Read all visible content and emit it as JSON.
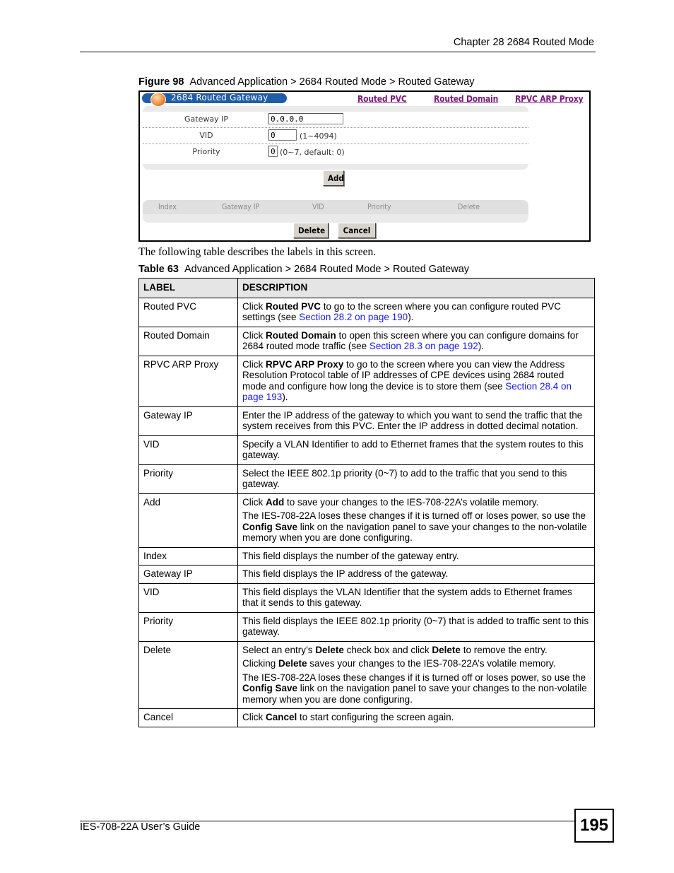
{
  "header": {
    "chapter": "Chapter 28 2684 Routed Mode"
  },
  "figure": {
    "label": "Figure 98",
    "caption": "Advanced Application > 2684 Routed Mode > Routed Gateway",
    "screen": {
      "title": "2684 Routed Gateway",
      "title_icon": "orange-ball-icon",
      "tabs": [
        {
          "label": "Routed PVC"
        },
        {
          "label": "Routed Domain"
        },
        {
          "label": "RPVC ARP Proxy"
        }
      ],
      "fields": [
        {
          "label": "Gateway IP",
          "value": "0.0.0.0",
          "hint": ""
        },
        {
          "label": "VID",
          "value": "0",
          "hint": "(1~4094)"
        },
        {
          "label": "Priority",
          "value": "0",
          "hint": "(0~7, default: 0)"
        }
      ],
      "add_label": "Add",
      "list_columns": [
        "Index",
        "Gateway IP",
        "VID",
        "Priority",
        "Delete"
      ],
      "delete_label": "Delete",
      "cancel_label": "Cancel"
    }
  },
  "intro": "The following table describes the labels in this screen.",
  "table": {
    "label": "Table 63",
    "caption": "Advanced Application > 2684 Routed Mode > Routed Gateway",
    "headers": [
      "LABEL",
      "DESCRIPTION"
    ],
    "rows": [
      {
        "label": "Routed PVC",
        "paragraphs": [
          [
            {
              "t": "Click "
            },
            {
              "t": "Routed PVC",
              "b": true
            },
            {
              "t": " to go to the screen where you can configure routed PVC settings (see "
            },
            {
              "t": "Section 28.2 on page 190",
              "link": true
            },
            {
              "t": ")."
            }
          ]
        ]
      },
      {
        "label": "Routed Domain",
        "paragraphs": [
          [
            {
              "t": "Click "
            },
            {
              "t": "Routed Domain",
              "b": true
            },
            {
              "t": " to open this screen where you can configure domains for 2684 routed mode traffic (see "
            },
            {
              "t": "Section 28.3 on page 192",
              "link": true
            },
            {
              "t": ")."
            }
          ]
        ]
      },
      {
        "label": "RPVC ARP Proxy",
        "paragraphs": [
          [
            {
              "t": "Click "
            },
            {
              "t": "RPVC ARP Proxy",
              "b": true
            },
            {
              "t": " to go to the screen where you can view the Address Resolution Protocol table of IP addresses of CPE devices using 2684 routed mode and configure how long the device is to store them (see "
            },
            {
              "t": "Section 28.4 on page 193",
              "link": true
            },
            {
              "t": ")."
            }
          ]
        ]
      },
      {
        "label": "Gateway IP",
        "paragraphs": [
          [
            {
              "t": "Enter the IP address of the gateway to which you want to send the traffic that the system receives from this PVC. Enter the IP address in dotted decimal notation."
            }
          ]
        ]
      },
      {
        "label": "VID",
        "paragraphs": [
          [
            {
              "t": "Specify a VLAN Identifier to add to Ethernet frames that the system routes to this gateway."
            }
          ]
        ]
      },
      {
        "label": "Priority",
        "paragraphs": [
          [
            {
              "t": "Select the IEEE 802.1p priority (0~7) to add to the traffic that you send to this gateway."
            }
          ]
        ]
      },
      {
        "label": "Add",
        "paragraphs": [
          [
            {
              "t": "Click "
            },
            {
              "t": "Add",
              "b": true
            },
            {
              "t": " to save your changes to the IES-708-22A’s volatile memory."
            }
          ],
          [
            {
              "t": "The IES-708-22A loses these changes if it is turned off or loses power, so use the "
            },
            {
              "t": "Config Save",
              "b": true
            },
            {
              "t": " link on the navigation panel to save your changes to the non-volatile memory when you are done configuring."
            }
          ]
        ]
      },
      {
        "label": "Index",
        "paragraphs": [
          [
            {
              "t": "This field displays the number of the gateway entry."
            }
          ]
        ]
      },
      {
        "label": "Gateway IP",
        "paragraphs": [
          [
            {
              "t": "This field displays the IP address of the gateway."
            }
          ]
        ]
      },
      {
        "label": "VID",
        "paragraphs": [
          [
            {
              "t": "This field displays the VLAN Identifier that the system adds to Ethernet frames that it sends to this gateway."
            }
          ]
        ]
      },
      {
        "label": "Priority",
        "paragraphs": [
          [
            {
              "t": "This field displays the IEEE 802.1p priority (0~7) that is added to traffic sent to this gateway."
            }
          ]
        ]
      },
      {
        "label": "Delete",
        "paragraphs": [
          [
            {
              "t": "Select an entry’s "
            },
            {
              "t": "Delete",
              "b": true
            },
            {
              "t": " check box and click "
            },
            {
              "t": "Delete",
              "b": true
            },
            {
              "t": " to remove the entry."
            }
          ],
          [
            {
              "t": "Clicking "
            },
            {
              "t": "Delete",
              "b": true
            },
            {
              "t": " saves your changes to the IES-708-22A’s volatile memory."
            }
          ],
          [
            {
              "t": "The IES-708-22A loses these changes if it is turned off or loses power, so use the "
            },
            {
              "t": "Config Save",
              "b": true
            },
            {
              "t": " link on the navigation panel to save your changes to the non-volatile memory when you are done configuring."
            }
          ]
        ]
      },
      {
        "label": "Cancel",
        "paragraphs": [
          [
            {
              "t": "Click "
            },
            {
              "t": "Cancel",
              "b": true
            },
            {
              "t": " to start configuring the screen again."
            }
          ]
        ]
      }
    ]
  },
  "footer": {
    "guide": "IES-708-22A User’s Guide",
    "page_number": "195"
  },
  "colors": {
    "title_bar": "#1f5da8",
    "tab_link": "#7b1a7b",
    "xref_link": "#1a1aee",
    "panel_bg": "#eaeaea",
    "table_header_bg": "#e5e5e5"
  }
}
